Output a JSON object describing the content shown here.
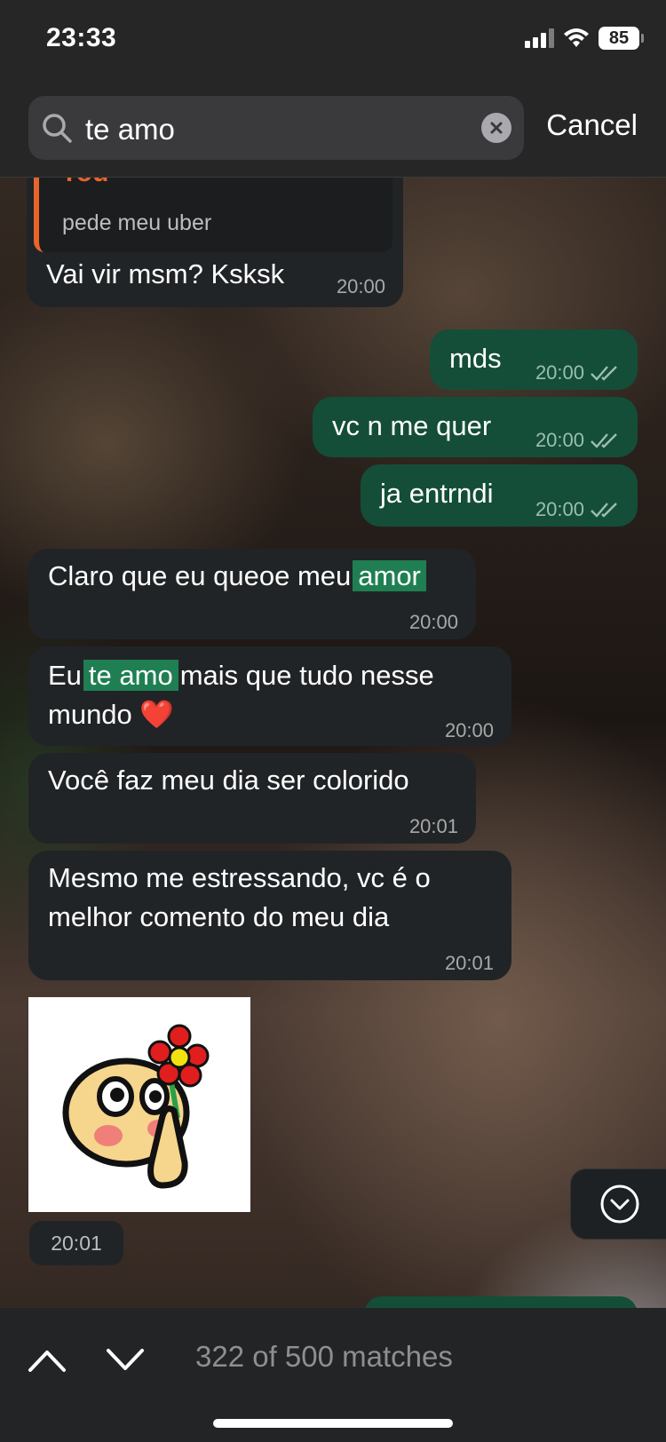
{
  "status_bar": {
    "time": "23:33",
    "battery": "85",
    "icons": [
      "signal-icon",
      "wifi-icon",
      "battery-icon"
    ]
  },
  "search": {
    "query": "te amo",
    "cancel_label": "Cancel",
    "icons": [
      "search-icon",
      "clear-icon"
    ]
  },
  "messages": [
    {
      "direction": "in",
      "reply_name": "You",
      "reply_text": "pede meu uber",
      "text": "Vai vir msm? Ksksk",
      "time": "20:00"
    },
    {
      "direction": "out",
      "text": "mds",
      "time": "20:00",
      "status": "read"
    },
    {
      "direction": "out",
      "text": "vc n me quer",
      "time": "20:00",
      "status": "read"
    },
    {
      "direction": "out",
      "text": "ja entrndi",
      "time": "20:00",
      "status": "read"
    },
    {
      "direction": "in",
      "text_before": "Claro que eu queoe meu",
      "highlight": "amor",
      "time": "20:00"
    },
    {
      "direction": "in",
      "text_before": "Eu",
      "highlight": "te amo",
      "text_after": "mais que tudo nesse",
      "text_line2": "mundo ❤️",
      "time": "20:00"
    },
    {
      "direction": "in",
      "text": "Você faz meu dia ser colorido",
      "time": "20:01"
    },
    {
      "direction": "in",
      "text_line1": "Mesmo me estressando, vc é o",
      "text_line2": "melhor comento do meu dia",
      "time": "20:01"
    },
    {
      "direction": "in",
      "type": "sticker",
      "sticker_icon": "cursed-emoji-flower-sticker",
      "time": "20:01"
    }
  ],
  "bottom_bar": {
    "matches": "322 of 500 matches",
    "icons": [
      "chevron-up-icon",
      "chevron-down-icon"
    ]
  },
  "colors": {
    "incoming_bubble": "#212426",
    "outgoing_bubble": "#144e38",
    "highlight": "#1f7f52",
    "reply_accent": "#e8642c"
  }
}
